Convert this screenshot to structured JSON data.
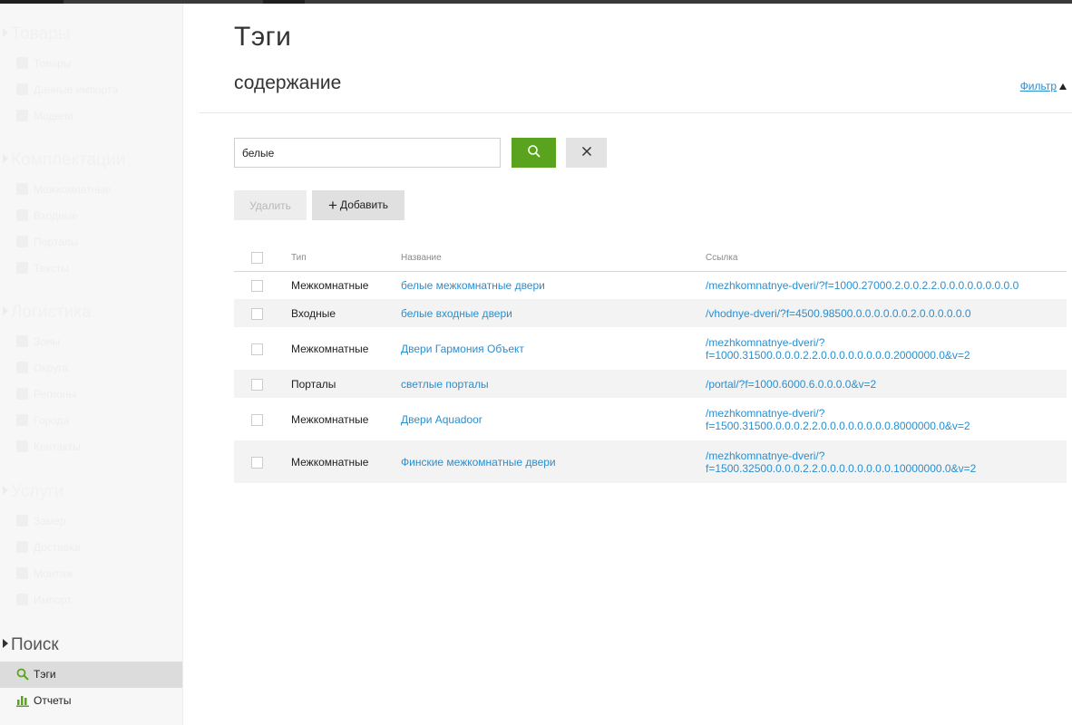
{
  "sidebar": {
    "sections": [
      {
        "title": "Товары",
        "items": [
          "Товары",
          "Данные импорта",
          "Модели"
        ]
      },
      {
        "title": "Комплектации",
        "items": [
          "Межкомнатные",
          "Входные",
          "Порталы",
          "Тексты"
        ]
      },
      {
        "title": "Логистика",
        "items": [
          "Зоны",
          "Округа",
          "Регионы",
          "Города",
          "Контакты"
        ]
      },
      {
        "title": "Услуги",
        "items": [
          "Замер",
          "Доставка",
          "Монтаж",
          "Импорт"
        ]
      }
    ],
    "search_section": {
      "title": "Поиск",
      "items": [
        {
          "label": "Тэги",
          "icon": "search-icon",
          "selected": true
        },
        {
          "label": "Отчеты",
          "icon": "bar-chart-icon",
          "selected": false
        }
      ]
    }
  },
  "main": {
    "title": "Тэги",
    "subtitle": "содержание",
    "filter_label": "Фильтр",
    "search": {
      "value": "белые",
      "placeholder": ""
    },
    "buttons": {
      "delete": "Удалить",
      "add": "Добавить"
    },
    "table": {
      "headers": {
        "type": "Тип",
        "name": "Название",
        "link": "Ссылка"
      },
      "rows": [
        {
          "type": "Межкомнатные",
          "name": "белые межкомнатные двери",
          "link": [
            "/mezhkomnatnye-dveri/?f=1000.27000.2.0.0.2.2.0.0.0.0.0.0.0.0.0"
          ]
        },
        {
          "type": "Входные",
          "name": "белые входные двери",
          "link": [
            "/vhodnye-dveri/?f=4500.98500.0.0.0.0.0.0.2.0.0.0.0.0.0"
          ]
        },
        {
          "type": "Межкомнатные",
          "name": "Двери Гармония Объект",
          "link": [
            "/mezhkomnatnye-dveri/?",
            "f=1000.31500.0.0.0.2.2.0.0.0.0.0.0.0.0.2000000.0&v=2"
          ]
        },
        {
          "type": "Порталы",
          "name": "светлые порталы",
          "link": [
            "/portal/?f=1000.6000.6.0.0.0.0&v=2"
          ]
        },
        {
          "type": "Межкомнатные",
          "name": "Двери Aquadoor",
          "link": [
            "/mezhkomnatnye-dveri/?",
            "f=1500.31500.0.0.0.2.2.0.0.0.0.0.0.0.0.8000000.0&v=2"
          ]
        },
        {
          "type": "Межкомнатные",
          "name": "Финские межкомнатные двери",
          "link": [
            "/mezhkomnatnye-dveri/?",
            "f=1500.32500.0.0.0.2.2.0.0.0.0.0.0.0.0.10000000.0&v=2"
          ]
        }
      ]
    }
  },
  "colors": {
    "accent_green": "#5aa31f",
    "link_blue": "#2a8fd0"
  }
}
